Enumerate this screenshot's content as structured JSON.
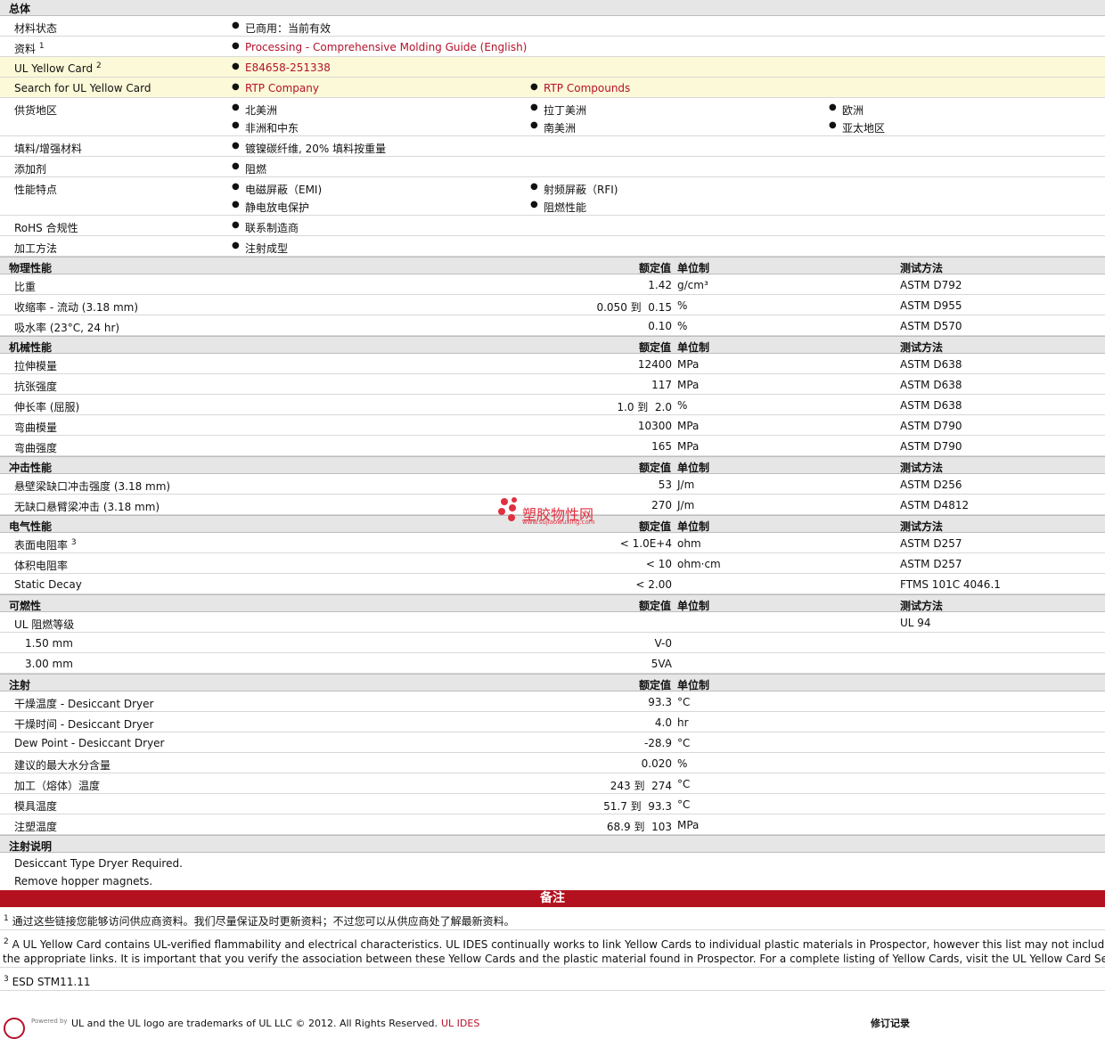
{
  "general": {
    "title": "总体",
    "material_status": {
      "label": "材料状态",
      "value": "已商用：当前有效"
    },
    "literature": {
      "label": "资料",
      "sup": "1",
      "link": "Processing - Comprehensive Molding Guide (English)"
    },
    "yellow_card": {
      "label": "UL Yellow Card",
      "sup": "2",
      "link": "E84658-251338"
    },
    "search_yellow_card": {
      "label": "Search for UL Yellow Card",
      "links": [
        "RTP Company",
        "RTP Compounds"
      ]
    },
    "availability": {
      "label": "供货地区",
      "items": [
        "北美洲",
        "拉丁美洲",
        "欧洲",
        "非洲和中东",
        "南美洲",
        "亚太地区"
      ]
    },
    "filler": {
      "label": "填料/增强材料",
      "value": "镀镍碳纤维, 20% 填料按重量"
    },
    "additive": {
      "label": "添加剂",
      "value": "阻燃"
    },
    "features": {
      "label": "性能特点",
      "items": [
        "电磁屏蔽（EMI)",
        "射频屏蔽（RFI)",
        "静电放电保护",
        "阻燃性能"
      ]
    },
    "rohs": {
      "label": "RoHS 合规性",
      "value": "联系制造商"
    },
    "processing": {
      "label": "加工方法",
      "value": "注射成型"
    }
  },
  "col_headers": {
    "nominal": "额定值",
    "unit": "单位制",
    "method": "测试方法"
  },
  "physical": {
    "title": "物理性能",
    "rows": [
      {
        "label": "比重",
        "value": "1.42",
        "unit": "g/cm³",
        "method": "ASTM D792"
      },
      {
        "label": "收缩率 - 流动 (3.18 mm)",
        "value": "0.050 到  0.15",
        "unit": "%",
        "method": "ASTM D955"
      },
      {
        "label": "吸水率 (23°C, 24 hr)",
        "value": "0.10",
        "unit": "%",
        "method": "ASTM D570"
      }
    ]
  },
  "mechanical": {
    "title": "机械性能",
    "rows": [
      {
        "label": "拉伸模量",
        "value": "12400",
        "unit": "MPa",
        "method": "ASTM D638"
      },
      {
        "label": "抗张强度",
        "value": "117",
        "unit": "MPa",
        "method": "ASTM D638"
      },
      {
        "label": "伸长率 (屈服)",
        "value": "1.0 到  2.0",
        "unit": "%",
        "method": "ASTM D638"
      },
      {
        "label": "弯曲模量",
        "value": "10300",
        "unit": "MPa",
        "method": "ASTM D790"
      },
      {
        "label": "弯曲强度",
        "value": "165",
        "unit": "MPa",
        "method": "ASTM D790"
      }
    ]
  },
  "impact": {
    "title": "冲击性能",
    "rows": [
      {
        "label": "悬壁梁缺口冲击强度 (3.18 mm)",
        "value": "53",
        "unit": "J/m",
        "method": "ASTM D256"
      },
      {
        "label": "无缺口悬臂梁冲击 (3.18 mm)",
        "value": "270",
        "unit": "J/m",
        "method": "ASTM D4812"
      }
    ]
  },
  "electrical": {
    "title": "电气性能",
    "rows": [
      {
        "label": "表面电阻率",
        "sup": "3",
        "value": "< 1.0E+4",
        "unit": "ohm",
        "method": "ASTM D257"
      },
      {
        "label": "体积电阻率",
        "value": "< 10",
        "unit": "ohm·cm",
        "method": "ASTM D257"
      },
      {
        "label": "Static Decay",
        "value": "< 2.00",
        "unit": "",
        "method": "FTMS 101C 4046.1"
      }
    ]
  },
  "flammability": {
    "title": "可燃性",
    "rows": [
      {
        "label": "UL 阻燃等级",
        "value": "",
        "unit": "",
        "method": "UL 94"
      },
      {
        "label": "1.50 mm",
        "value": "V-0",
        "unit": "",
        "method": ""
      },
      {
        "label": "3.00 mm",
        "value": "5VA",
        "unit": "",
        "method": ""
      }
    ]
  },
  "injection": {
    "title": "注射",
    "rows": [
      {
        "label": "干燥温度 - Desiccant Dryer",
        "value": "93.3",
        "unit": "°C"
      },
      {
        "label": "干燥时间 - Desiccant Dryer",
        "value": "4.0",
        "unit": "hr"
      },
      {
        "label": "Dew Point - Desiccant Dryer",
        "value": "-28.9",
        "unit": "°C"
      },
      {
        "label": "建议的最大水分含量",
        "value": "0.020",
        "unit": "%"
      },
      {
        "label": "加工（熔体）温度",
        "value": "243 到  274",
        "unit": "°C"
      },
      {
        "label": "模具温度",
        "value": "51.7 到  93.3",
        "unit": "°C"
      },
      {
        "label": "注塑温度",
        "value": "68.9 到  103",
        "unit": "MPa"
      }
    ]
  },
  "injection_notes": {
    "title": "注射说明",
    "lines": [
      "Desiccant Type Dryer Required.",
      "Remove hopper magnets."
    ]
  },
  "notes": {
    "title": "备注",
    "fn1": {
      "num": "1",
      "text": "通过这些链接您能够访问供应商资料。我们尽量保证及时更新资料；不过您可以从供应商处了解最新资料。"
    },
    "fn2": {
      "num": "2",
      "line1": "A UL Yellow Card contains UL-verified flammability and electrical characteristics. UL IDES continually works to link Yellow Cards to individual plastic materials in Prospector, however this list may not include all o",
      "line2": "the appropriate links. It is important that you verify the association between these Yellow Cards and the plastic material found in Prospector. For a complete listing of Yellow Cards, visit the UL Yellow Card Search."
    },
    "fn3": {
      "num": "3",
      "text": "ESD STM11.11"
    }
  },
  "watermark": {
    "cn": "塑胶物性网",
    "url": "www.sujiaowuxing.com"
  },
  "footer": {
    "powered_by": "Powered by",
    "trademark": "UL and the UL logo are trademarks of UL LLC © 2012. All Rights Reserved.",
    "ides": "UL IDES",
    "revision": "修订记录"
  }
}
